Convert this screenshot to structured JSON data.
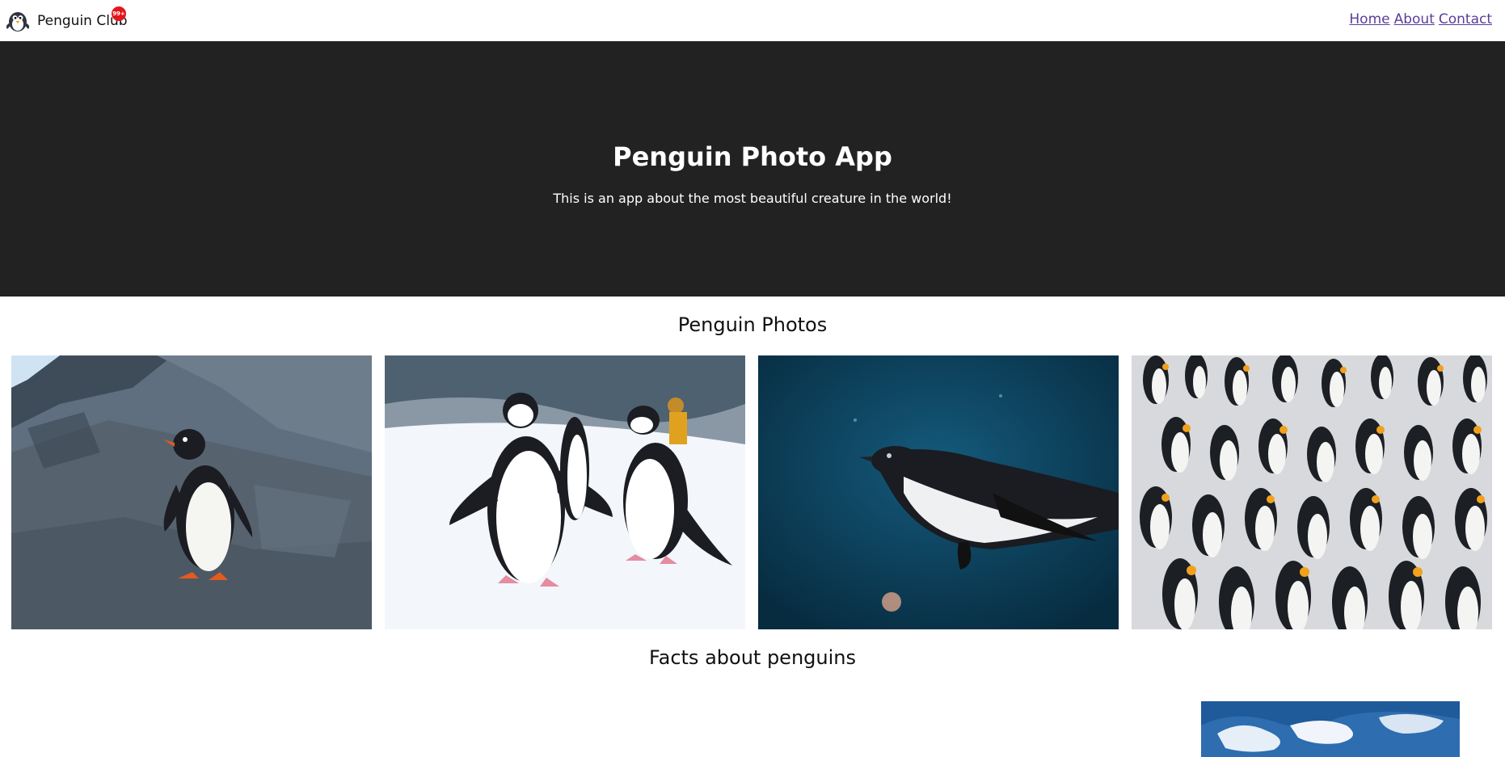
{
  "nav": {
    "brand_name": "Penguin Club",
    "badge": "99+",
    "logo_icon": "penguin-logo-icon",
    "links": [
      {
        "label": "Home"
      },
      {
        "label": "About"
      },
      {
        "label": "Contact"
      }
    ]
  },
  "hero": {
    "title": "Penguin Photo App",
    "subtitle": "This is an app about the most beautiful creature in the world!"
  },
  "sections": {
    "photos_title": "Penguin Photos",
    "facts_title": "Facts about penguins"
  },
  "colors": {
    "hero_bg": "#222222",
    "link": "#5b3e9a",
    "badge": "#e3161b"
  }
}
